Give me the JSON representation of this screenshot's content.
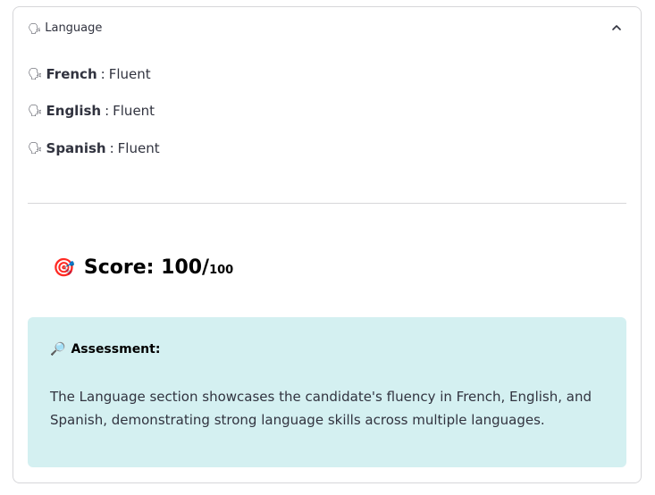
{
  "expander": {
    "icon": "speaking-head-icon",
    "title": "Language",
    "chevron": "chevron-up-icon"
  },
  "languages": [
    {
      "icon": "speaking-head-icon",
      "name": "French",
      "separator": ":",
      "level": "Fluent"
    },
    {
      "icon": "speaking-head-icon",
      "name": "English",
      "separator": ":",
      "level": "Fluent"
    },
    {
      "icon": "speaking-head-icon",
      "name": "Spanish",
      "separator": ":",
      "level": "Fluent"
    }
  ],
  "score": {
    "icon": "target-icon",
    "label": "Score: 100/",
    "max": "100"
  },
  "assessment": {
    "icon": "magnifier-icon",
    "title": "Assessment:",
    "text": "The Language section showcases the candidate's fluency in French, English, and Spanish, demonstrating strong language skills across multiple languages.",
    "background": "#d4f0f1"
  }
}
